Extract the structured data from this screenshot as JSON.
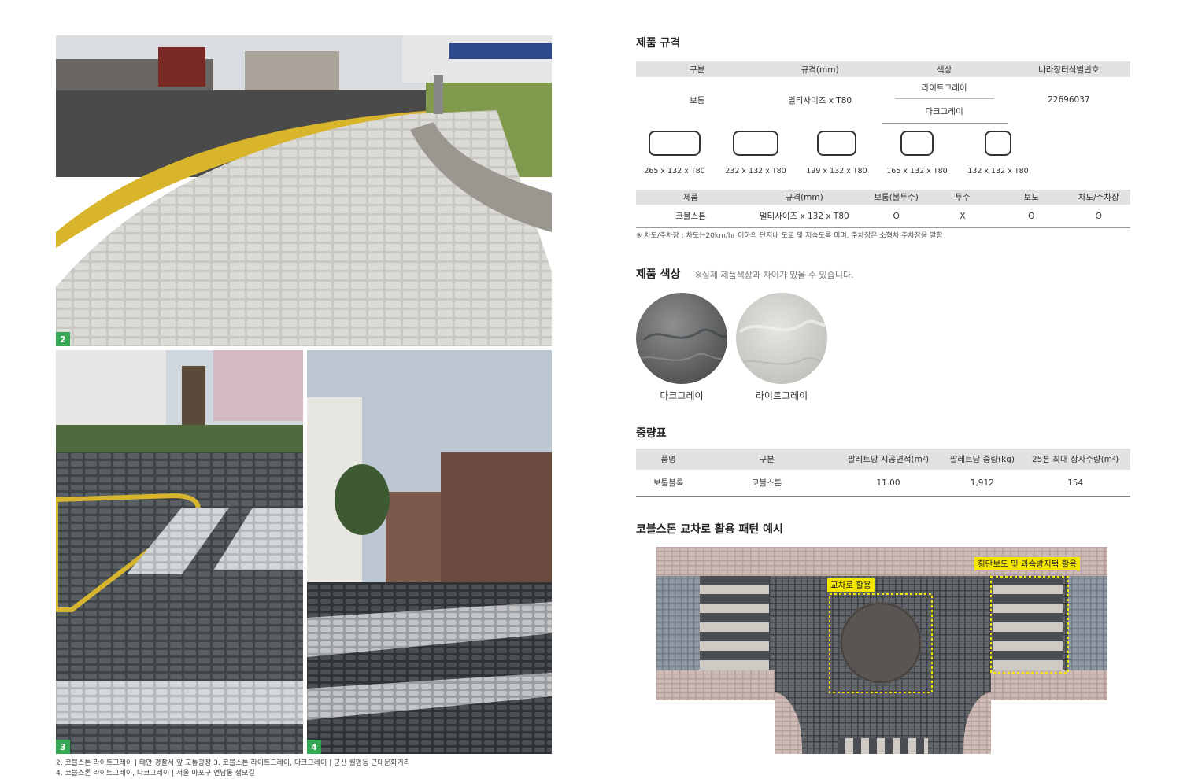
{
  "photos": [
    {
      "badge": "2"
    },
    {
      "badge": "3"
    },
    {
      "badge": "4"
    }
  ],
  "captions": {
    "line1": "2. 코블스톤 라이트그레이 | 태안 경찰서 앞 교통광장   3. 코블스톤 라이트그레이, 다크그레이 | 군산 월명동 근대문화거리",
    "line2": "4. 코블스톤 라이트그레이, 다크그레이 | 서울 마포구 연남동 생모길"
  },
  "spec": {
    "title": "제품 규격",
    "headers": [
      "구분",
      "규격(mm)",
      "색상",
      "나라장터식별번호"
    ],
    "row": {
      "type": "보통",
      "size": "멀티사이즈 x T80",
      "colors": [
        "라이트그레이",
        "다크그레이"
      ],
      "id": "22696037"
    },
    "shapes": [
      {
        "label": "265 x 132 x T80",
        "w": 265
      },
      {
        "label": "232 x 132 x T80",
        "w": 232
      },
      {
        "label": "199 x 132 x T80",
        "w": 199
      },
      {
        "label": "165 x 132 x T80",
        "w": 165
      },
      {
        "label": "132 x 132 x T80",
        "w": 132
      }
    ],
    "headers2": [
      "제품",
      "규격(mm)",
      "보통(불투수)",
      "투수",
      "보도",
      "차도/주차장"
    ],
    "row2": [
      "코블스톤",
      "멀티사이즈 x 132 x T80",
      "O",
      "X",
      "O",
      "O"
    ],
    "footnote": "※ 차도/주차장 : 차도는20km/hr 이하의 단지내 도로 및 저속도록 미며, 주차장은 소형차 주차장을 말함"
  },
  "colors": {
    "title": "제품 색상",
    "note": "※실제 제품색상과 차이가 있을 수 있습니다.",
    "items": [
      {
        "label": "다크그레이",
        "hex": "#6f7173"
      },
      {
        "label": "라이트그레이",
        "hex": "#d4d3cf"
      }
    ]
  },
  "weight": {
    "title": "중량표",
    "headers": [
      "품명",
      "구분",
      "팔레트당 시공면적(m²)",
      "팔레트당 중량(kg)",
      "25톤 최대 상자수량(m²)"
    ],
    "row": [
      "보통블록",
      "코블스톤",
      "11.00",
      "1,912",
      "154"
    ]
  },
  "pattern": {
    "title": "코블스톤 교차로 활용 패턴 예시",
    "tag_cross": "교차로 활용",
    "tag_walk": "횡단보도 및 과속방지턱 활용"
  }
}
